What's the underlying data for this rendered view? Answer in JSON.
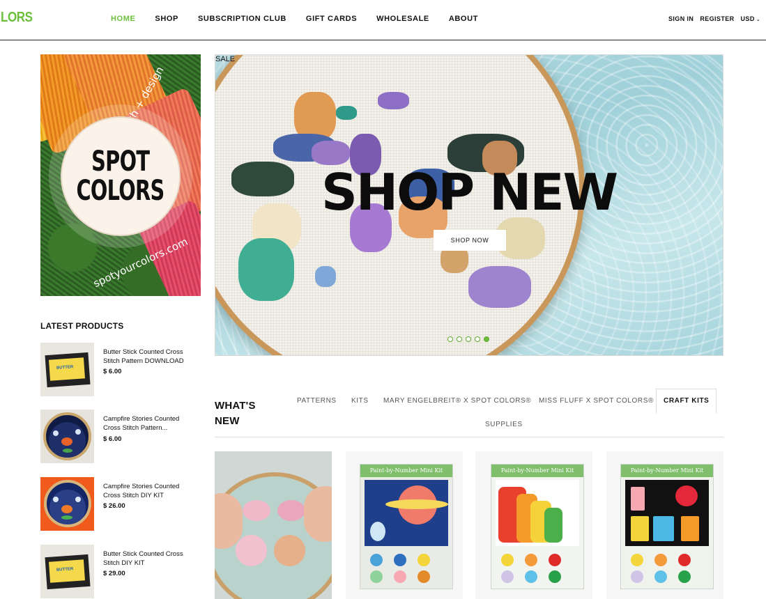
{
  "header": {
    "logo": "LORS",
    "nav": [
      {
        "label": "HOME",
        "active": true
      },
      {
        "label": "SHOP",
        "active": false
      },
      {
        "label": "SUBSCRIPTION CLUB",
        "active": false
      },
      {
        "label": "GIFT CARDS",
        "active": false
      },
      {
        "label": "WHOLESALE",
        "active": false
      },
      {
        "label": "ABOUT",
        "active": false
      }
    ],
    "sign_in": "SIGN IN",
    "register": "REGISTER",
    "currency": "USD"
  },
  "promo": {
    "line1": "SPOT",
    "line2": "COLORS",
    "ring_top": "modern cross stitch + design",
    "ring_bottom": "spotyourcolors.com"
  },
  "latest": {
    "title": "LATEST PRODUCTS",
    "items": [
      {
        "name": "Butter Stick Counted Cross Stitch Pattern DOWNLOAD",
        "price": "$ 6.00",
        "thumb": "butter"
      },
      {
        "name": "Campfire Stories Counted Cross Stitch Pattern...",
        "price": "$ 6.00",
        "thumb": "hoop1"
      },
      {
        "name": "Campfire Stories Counted Cross Stitch DIY KIT",
        "price": "$ 26.00",
        "thumb": "hoop2"
      },
      {
        "name": "Butter Stick Counted Cross Stitch DIY KIT",
        "price": "$ 29.00",
        "thumb": "butter"
      }
    ]
  },
  "hero": {
    "sale_label": "SALE",
    "title": "SHOP NEW",
    "button": "SHOP NOW",
    "slides": 5,
    "active_slide": 5
  },
  "whats_new": {
    "title_line1": "WHAT'S",
    "title_line2": "NEW",
    "tabs": [
      {
        "label": "PATTERNS",
        "active": false
      },
      {
        "label": "KITS",
        "active": false
      },
      {
        "label": "MARY ENGELBREIT® X SPOT COLORS®",
        "active": false
      },
      {
        "label": "MISS FLUFF X SPOT COLORS®",
        "active": false
      },
      {
        "label": "CRAFT KITS",
        "active": true
      },
      {
        "label": "SUPPLIES",
        "active": false
      }
    ],
    "kit_header": "Paint-by-Number Mini Kit"
  },
  "colors": {
    "accent": "#6bbf3a",
    "text": "#111111"
  }
}
